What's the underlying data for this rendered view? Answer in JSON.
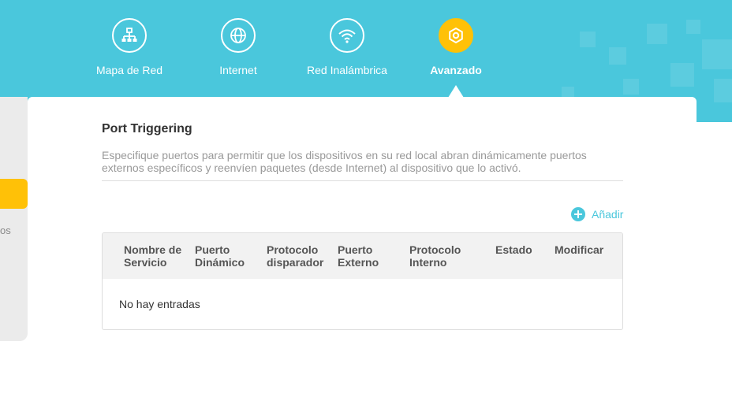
{
  "nav": {
    "items": [
      {
        "label": "Mapa de Red",
        "icon": "network-map-icon"
      },
      {
        "label": "Internet",
        "icon": "globe-icon"
      },
      {
        "label": "Red Inalámbrica",
        "icon": "wifi-icon"
      },
      {
        "label": "Avanzado",
        "icon": "gear-icon",
        "active": true
      }
    ]
  },
  "sidebar": {
    "partial_item_text": "os"
  },
  "main": {
    "title": "Port Triggering",
    "description": "Especifique puertos para permitir que los dispositivos en su red local abran dinámicamente puertos externos específicos y reenvíen paquetes (desde Internet) al dispositivo que lo activó.",
    "add_label": "Añadir",
    "table": {
      "columns": [
        "Nombre de Servicio",
        "Puerto Dinámico",
        "Protocolo disparador",
        "Puerto Externo",
        "Protocolo Interno",
        "Estado",
        "Modificar"
      ],
      "empty_text": "No hay entradas"
    }
  },
  "colors": {
    "header": "#4ac7dc",
    "accent": "#ffc107",
    "link": "#4ac7dc"
  }
}
